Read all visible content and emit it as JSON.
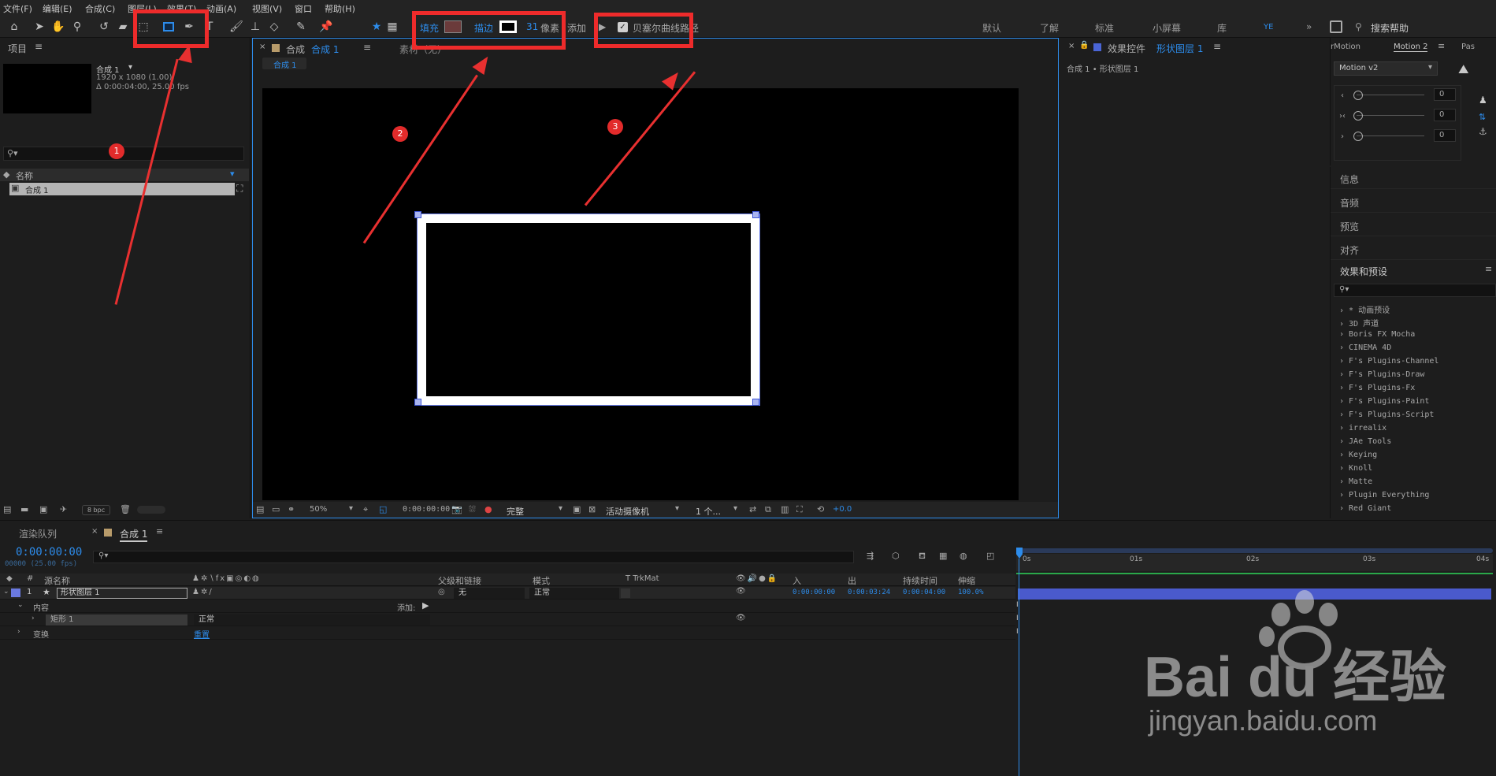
{
  "menu": [
    "文件(F)",
    "编辑(E)",
    "合成(C)",
    "图层(L)",
    "效果(T)",
    "动画(A)",
    "视图(V)",
    "窗口",
    "帮助(H)"
  ],
  "toolbar": {
    "fill_label": "填充",
    "stroke_label": "描边",
    "stroke_width": "31",
    "stroke_unit": "像素",
    "add_label": "添加",
    "bezier_label": "贝塞尔曲线路径",
    "fill_color": "#6b3b3b",
    "stroke_color": "#ffffff"
  },
  "workspaces": [
    "默认",
    "了解",
    "标准",
    "小屏幕",
    "库"
  ],
  "workspace_active": "YE",
  "search_help": "搜索帮助",
  "project": {
    "title": "项目",
    "comp_name": "合成 1",
    "comp_res": "1920 x 1080 (1.00)",
    "comp_dur": "Δ 0:00:04:00, 25.00 fps",
    "column_name": "名称",
    "item_label": "合成 1",
    "bpc": "8 bpc"
  },
  "composition": {
    "tab_prefix": "合成",
    "tab_name": "合成 1",
    "footage_tab": "素材（无）",
    "crumb": "合成 1",
    "zoom": "50%",
    "timecode": "0:00:00:00",
    "quality": "完整",
    "camera": "活动摄像机",
    "views": "1 个...",
    "exposure": "+0.0"
  },
  "effect_controls": {
    "title_prefix": "效果控件",
    "title_layer": "形状图层 1",
    "path": "合成 1 • 形状图层 1"
  },
  "motion": {
    "tab1": "rMotion",
    "tab2": "Motion 2",
    "tab3": "Pas",
    "preset": "Motion v2",
    "values": [
      "0",
      "0",
      "0"
    ]
  },
  "side_panels": [
    "信息",
    "音频",
    "预览",
    "对齐"
  ],
  "effects_presets": {
    "title": "效果和预设",
    "items": [
      "* 动画预设",
      "3D 声道",
      "Boris FX Mocha",
      "CINEMA 4D",
      "F's Plugins-Channel",
      "F's Plugins-Draw",
      "F's Plugins-Fx",
      "F's Plugins-Paint",
      "F's Plugins-Script",
      "irrealix",
      "JAe Tools",
      "Keying",
      "Knoll",
      "Matte",
      "Plugin Everything",
      "Red Giant"
    ]
  },
  "timeline": {
    "render_queue": "渲染队列",
    "comp_tab": "合成 1",
    "timecode": "0:00:00:00",
    "frames": "00000 (25.00 fps)",
    "col_source": "源名称",
    "col_parent": "父级和链接",
    "col_mode": "模式",
    "col_trkmat": "T  TrkMat",
    "col_in": "入",
    "col_out": "出",
    "col_dur": "持续时间",
    "col_stretch": "伸缩",
    "layer_num": "1",
    "layer_name": "形状图层 1",
    "layer_parent": "无",
    "layer_mode": "正常",
    "layer_in": "0:00:00:00",
    "layer_out": "0:00:03:24",
    "layer_dur": "0:00:04:00",
    "layer_stretch": "100.0%",
    "contents": "内容",
    "add": "添加:",
    "rect": "矩形 1",
    "rect_mode": "正常",
    "transform": "变换",
    "reset": "重置",
    "ruler": [
      "0s",
      "01s",
      "02s",
      "03s",
      "04s"
    ]
  },
  "annotations": [
    "1",
    "2",
    "3"
  ],
  "watermark": {
    "brand": "Bai du 经验",
    "url": "jingyan.baidu.com"
  }
}
